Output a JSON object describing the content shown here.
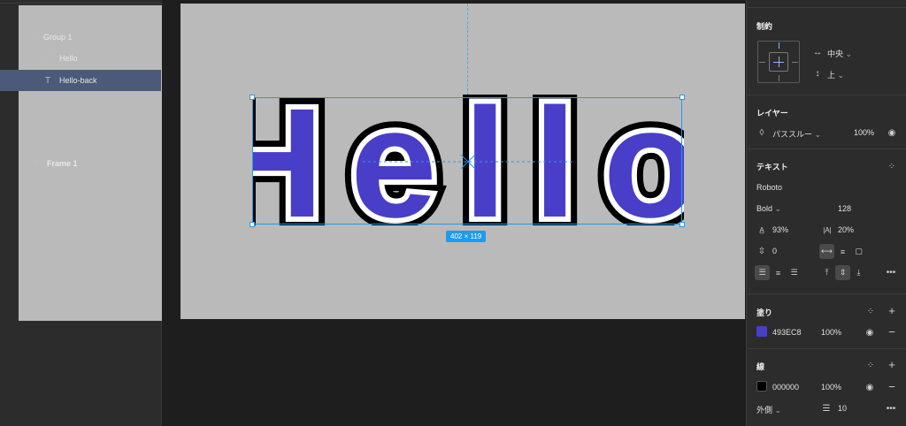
{
  "layers": {
    "items": [
      {
        "name": "Frame 1",
        "icon": "#"
      },
      {
        "name": "Group 1",
        "icon": "⁞⁞"
      },
      {
        "name": "Hello",
        "icon": "T"
      },
      {
        "name": "Hello-back",
        "icon": "T"
      }
    ]
  },
  "canvas": {
    "text": "Hello",
    "size_label": "402 × 119",
    "colors": {
      "frame_bg": "#BABABA",
      "fill": "#493EC8",
      "stroke": "#000000",
      "selection": "#1D9BF0"
    }
  },
  "props": {
    "constraints": {
      "title": "制約",
      "horizontal": "中央",
      "vertical": "上"
    },
    "layer": {
      "title": "レイヤー",
      "blend": "パススルー",
      "opacity": "100%"
    },
    "text": {
      "title": "テキスト",
      "font": "Roboto",
      "weight": "Bold",
      "size": "128",
      "line_height": "93%",
      "letter_spacing": "20%",
      "paragraph_spacing": "0"
    },
    "fill": {
      "title": "塗り",
      "hex": "493EC8",
      "opacity": "100%",
      "color": "#493EC8"
    },
    "stroke": {
      "title": "線",
      "hex": "000000",
      "opacity": "100%",
      "color": "#000000",
      "position": "外側",
      "weight": "10"
    }
  }
}
